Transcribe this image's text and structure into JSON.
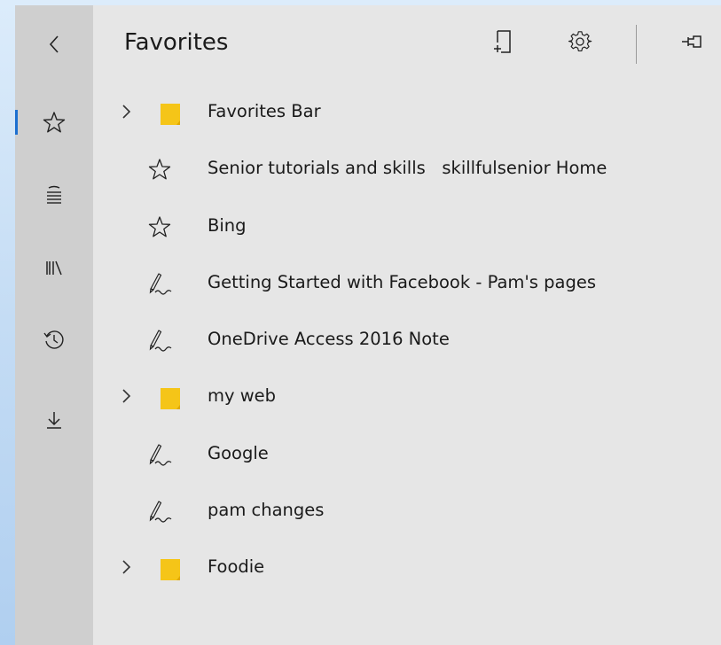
{
  "panel": {
    "title": "Favorites"
  },
  "rail": {
    "items": [
      {
        "name": "back",
        "icon": "chevron-left-icon"
      },
      {
        "name": "favorites",
        "icon": "star-icon",
        "active": true
      },
      {
        "name": "reading-list",
        "icon": "reading-list-icon"
      },
      {
        "name": "books",
        "icon": "books-icon"
      },
      {
        "name": "history",
        "icon": "history-icon"
      },
      {
        "name": "downloads",
        "icon": "download-icon"
      }
    ]
  },
  "header_actions": [
    {
      "name": "add-to-favorites",
      "icon": "add-favorite-icon"
    },
    {
      "name": "settings",
      "icon": "gear-icon"
    },
    {
      "name": "pin",
      "icon": "pin-icon"
    }
  ],
  "favorites": [
    {
      "type": "folder",
      "label": "Favorites Bar"
    },
    {
      "type": "favorite",
      "icon": "star-icon",
      "label": "Senior tutorials and skills   skillfulsenior Home"
    },
    {
      "type": "favorite",
      "icon": "star-icon",
      "label": "Bing"
    },
    {
      "type": "note",
      "icon": "pen-icon",
      "label": "Getting Started with Facebook - Pam's pages"
    },
    {
      "type": "note",
      "icon": "pen-icon",
      "label": "OneDrive Access 2016 Note"
    },
    {
      "type": "folder",
      "label": "my web"
    },
    {
      "type": "note",
      "icon": "pen-icon",
      "label": "Google"
    },
    {
      "type": "note",
      "icon": "pen-icon",
      "label": "pam changes"
    },
    {
      "type": "folder",
      "label": "Foodie"
    }
  ],
  "colors": {
    "folder": "#f5c518",
    "folder_shadow": "#e0a800",
    "accent": "#1c6fd0",
    "rail": "#cfcfcf",
    "panel": "#e6e6e6"
  }
}
